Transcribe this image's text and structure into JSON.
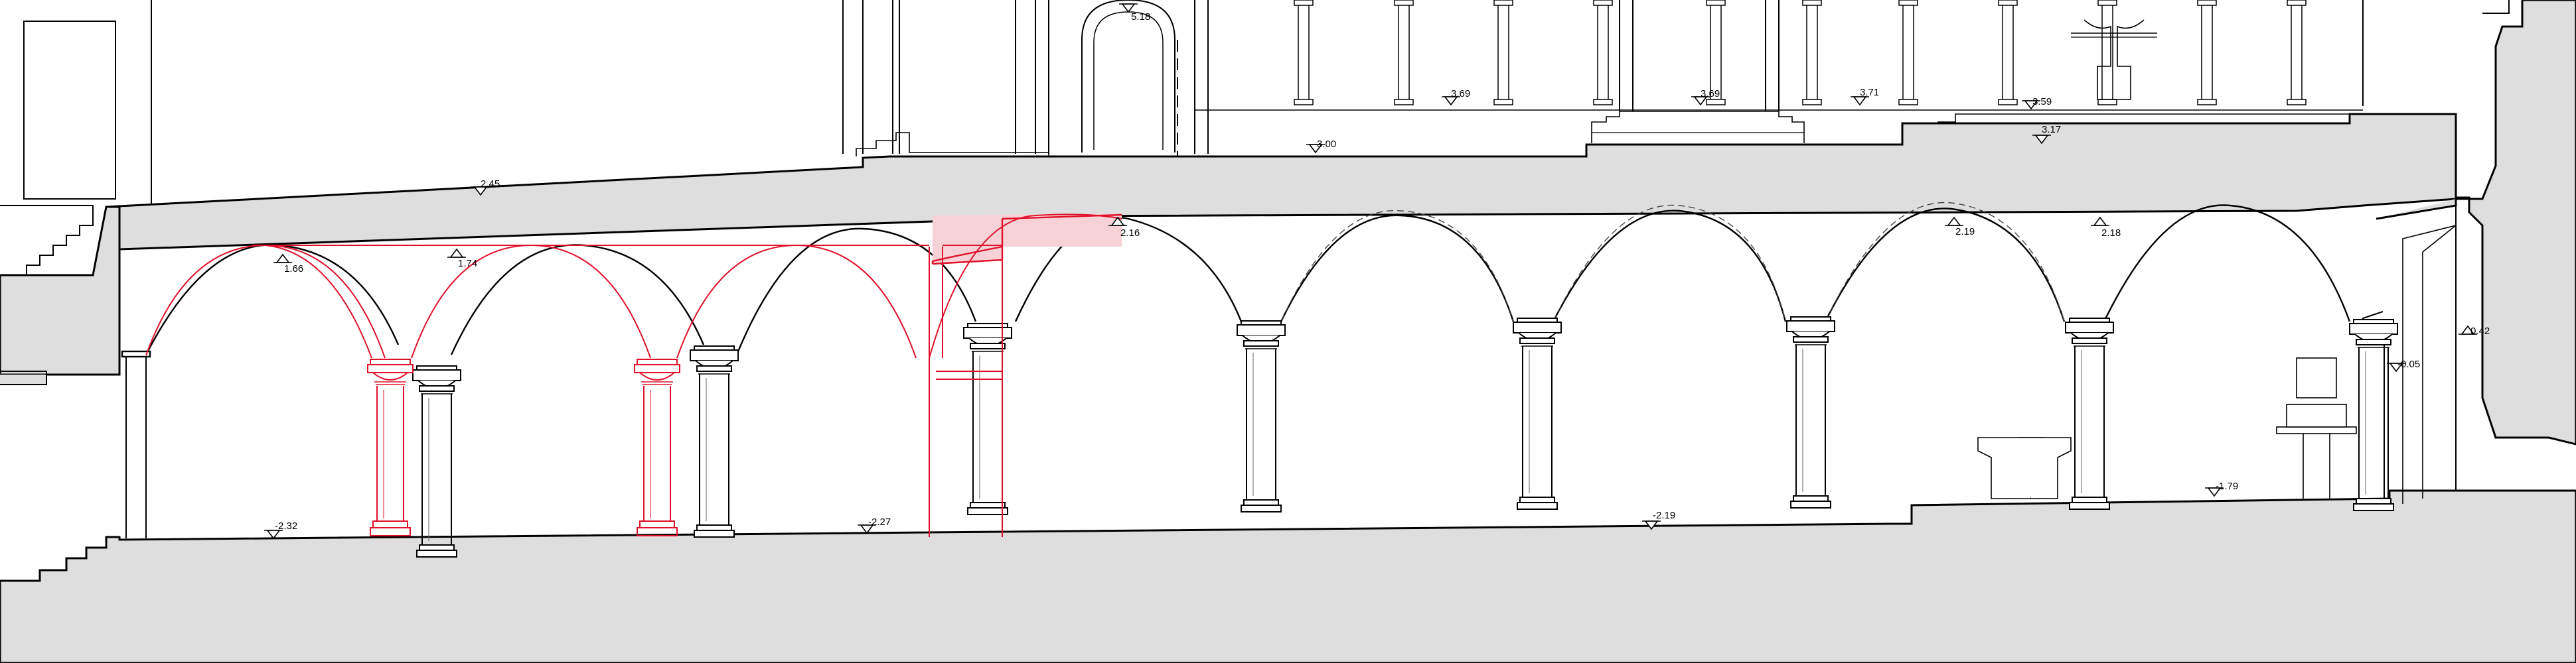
{
  "levels": {
    "l_518": "5.18",
    "l_369a": "3.69",
    "l_369b": "3.69",
    "l_371": "3.71",
    "l_359": "3.59",
    "l_317": "3.17",
    "l_300": "3.00",
    "l_245": "2.45",
    "l_216": "2.16",
    "l_219top": "2.19",
    "l_218": "2.18",
    "l_166": "1.66",
    "l_174": "1.74",
    "l_042": "0.42",
    "l_005": "-0.05",
    "l_232": "-2.32",
    "l_227": "-2.27",
    "l_219": "-2.19",
    "l_179": "-1.79"
  },
  "colors": {
    "section_fill": "#dedede",
    "line": "#000000",
    "hidden_line": "#6e6e6e",
    "reconstruction": "#e0102a",
    "reconstruction_fill": "#f6d2d7"
  }
}
